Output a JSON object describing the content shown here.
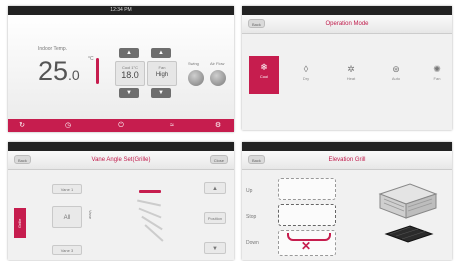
{
  "screen1": {
    "status_time": "12:34 PM",
    "indoor_label": "Indoor Temp.",
    "temp_int": "25",
    "temp_dec": ".0",
    "temp_unit": "°C",
    "cool_label": "Cool 1°C",
    "cool_value": "18.0",
    "fan_label": "Fan",
    "fan_value": "High",
    "knob1_label": "Swing",
    "knob2_label": "Air Flow",
    "nav": [
      {
        "icon": "↻"
      },
      {
        "icon": "◷"
      },
      {
        "icon": "⏻"
      },
      {
        "icon": "≈"
      },
      {
        "icon": "⚙"
      }
    ]
  },
  "screen2": {
    "back_label": "Back",
    "title": "Operation Mode",
    "modes": [
      {
        "icon": "❄",
        "label": "Cool"
      },
      {
        "icon": "◊",
        "label": "Dry"
      },
      {
        "icon": "✲",
        "label": "Heat"
      },
      {
        "icon": "⊛",
        "label": "Auto"
      },
      {
        "icon": "✺",
        "label": "Fan"
      }
    ]
  },
  "screen3": {
    "back_label": "Back",
    "title": "Vane Angle Set(Grille)",
    "close_label": "Close",
    "red_tab": "Grille",
    "vane1_label": "Vane 1",
    "all_label": "All",
    "vane2_label": "Vane 3",
    "vane_side": "Vane",
    "arrow_up": "▲",
    "arrow_down": "▼",
    "right_mid": "Position"
  },
  "screen4": {
    "back_label": "Back",
    "title": "Elevation Grill",
    "label_up": "Up",
    "label_stop": "Stop",
    "label_down": "Down"
  }
}
